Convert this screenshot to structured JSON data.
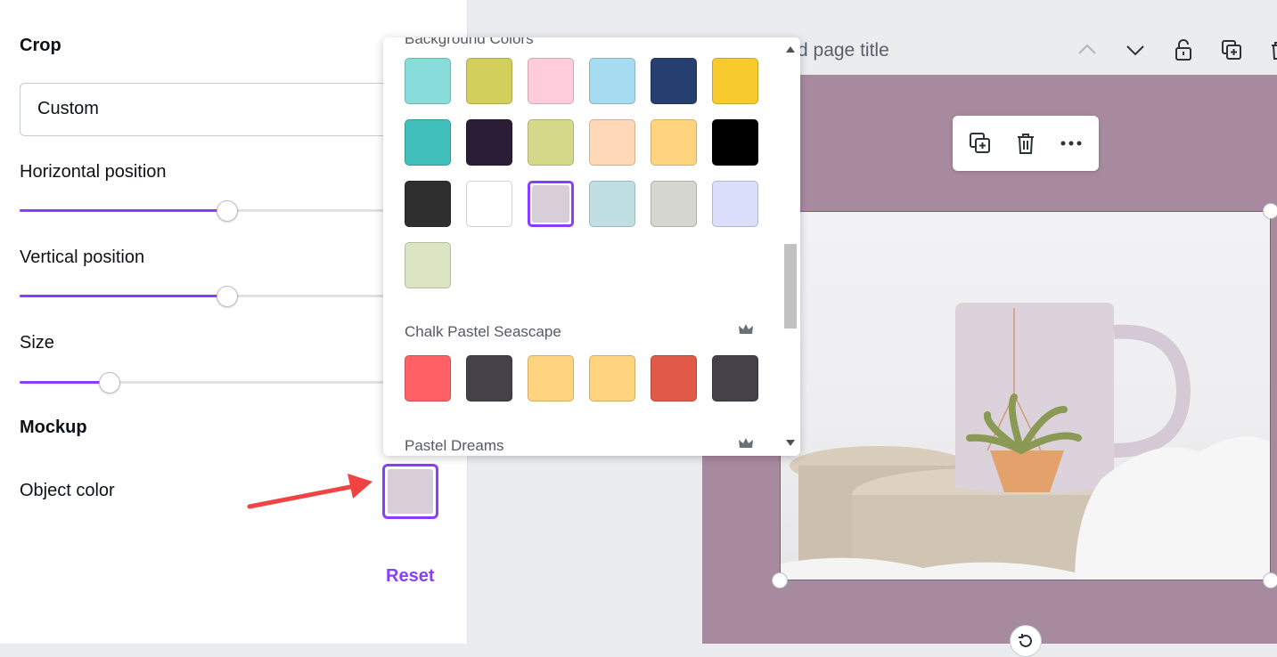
{
  "left_panel": {
    "crop_title": "Crop",
    "crop_select_value": "Custom",
    "horizontal_label": "Horizontal position",
    "horizontal_value": 0.53,
    "vertical_label": "Vertical position",
    "vertical_value": 0.53,
    "size_label": "Size",
    "size_value": 0.23,
    "mockup_title": "Mockup",
    "object_color_label": "Object color",
    "object_color_value": "#d8ced8",
    "reset_label": "Reset"
  },
  "canvas": {
    "page_title": "d page title",
    "page_bg": "#a88a9e"
  },
  "palette_popover": {
    "sections": [
      {
        "name": "Background Colors",
        "colors": [
          "#88dcda",
          "#d2cf5c",
          "#ffccdc",
          "#a6dcf0",
          "#273f70",
          "#f7cb2d",
          "#41c0bb",
          "#2b1d36",
          "#d5da8b",
          "#ffd8b8",
          "#ffd47f",
          "#000000",
          "#2f2f2f",
          "#ffffff",
          "#d8ced8",
          "#bfdfe2",
          "#d6d7d0",
          "#dcdffc",
          "#dbe5c4"
        ],
        "selected_index": 14
      },
      {
        "name": "Chalk Pastel Seascape",
        "colors": [
          "#ff6166",
          "#454149",
          "#ffd47e",
          "#ffd47e",
          "#e05a47",
          "#454149"
        ]
      },
      {
        "name": "Pastel Dreams",
        "colors": []
      }
    ]
  }
}
